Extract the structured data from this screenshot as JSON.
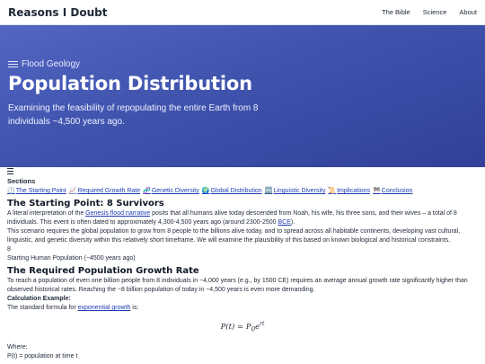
{
  "site": {
    "brand": "Reasons I Doubt",
    "nav": [
      "The Bible",
      "Science",
      "About"
    ]
  },
  "hero": {
    "category": "Flood Geology",
    "title": "Population Distribution",
    "subtitle": "Examining the feasibility of repopulating the entire Earth from 8 individuals ~4,500 years ago."
  },
  "sections": {
    "title": "Sections",
    "toc": [
      {
        "icon": "🕐",
        "label": "The Starting Point"
      },
      {
        "icon": "📈",
        "label": "Required Growth Rate"
      },
      {
        "icon": "🧬",
        "label": "Genetic Diversity"
      },
      {
        "icon": "🌍",
        "label": "Global Distribution"
      },
      {
        "icon": "🔤",
        "label": "Linguistic Diversity"
      },
      {
        "icon": "📜",
        "label": "Implications"
      },
      {
        "icon": "🏁",
        "label": "Conclusion"
      }
    ]
  },
  "starting_point": {
    "heading": "The Starting Point: 8 Survivors",
    "p1_a": "A literal interpretation of the ",
    "p1_link": "Genesis flood narrative",
    "p1_b": " posits that all humans alive today descended from Noah, his wife, his three sons, and their wives – a total of 8 individuals. This event is often dated to approximately 4,300-4,500 years ago (around 2300-2500 ",
    "p1_link2": "BCE",
    "p1_c": ").",
    "p2": "This scenario requires the global population to grow from 8 people to the billions alive today, and to spread across all habitable continents, developing vast cultural, linguistic, and genetic diversity within this relatively short timeframe. We will examine the plausibility of this based on known biological and historical constraints.",
    "stat_value": "8",
    "stat_label": "Starting Human Population (~4500 years ago)"
  },
  "growth": {
    "heading": "The Required Population Growth Rate",
    "p1": "To reach a population of even one billion people from 8 individuals in ~4,000 years (e.g., by 1500 CE) requires an average annual growth rate significantly higher than observed historical rates. Reaching the ~8 billion population of today in ~4,500 years is even more demanding.",
    "calc_label": "Calculation Example:",
    "p2_a": "The standard formula for ",
    "p2_link": "exponential growth",
    "p2_b": " is:",
    "formula_lhs": "P(t) = P",
    "formula_sub": "0",
    "formula_e": "e",
    "formula_sup": "rt",
    "where": "Where:",
    "where_item": "P(t) = population at time t"
  }
}
